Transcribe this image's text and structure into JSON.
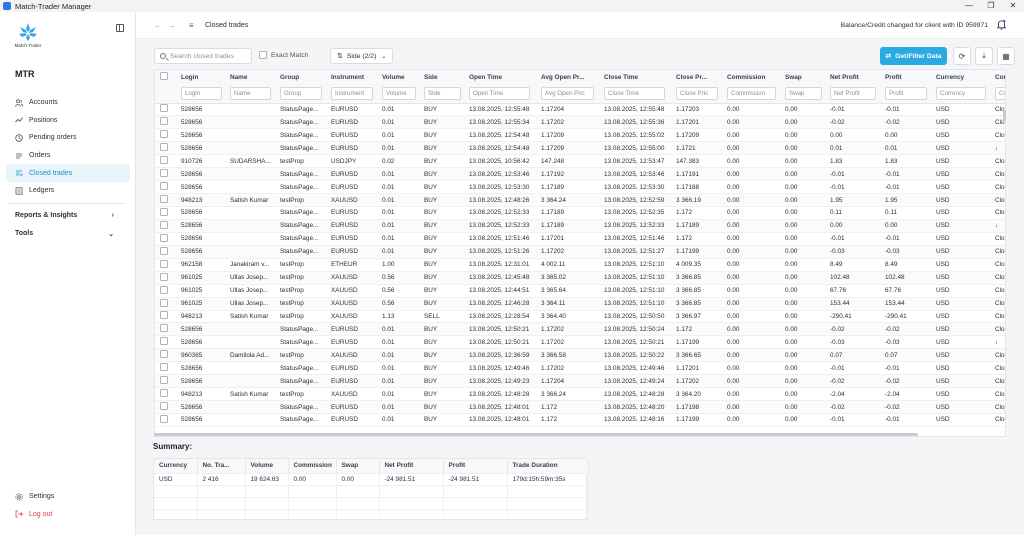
{
  "window": {
    "title": "Match-Trader Manager",
    "controls": [
      "—",
      "❐",
      "✕"
    ]
  },
  "sidebar": {
    "logo_text": "Match-Trader",
    "brand": "MTR",
    "items": [
      {
        "label": "Accounts",
        "icon": "users-icon"
      },
      {
        "label": "Positions",
        "icon": "positions-icon"
      },
      {
        "label": "Pending orders",
        "icon": "pending-icon"
      },
      {
        "label": "Orders",
        "icon": "orders-icon"
      },
      {
        "label": "Closed trades",
        "icon": "closed-trades-icon",
        "active": true
      },
      {
        "label": "Ledgers",
        "icon": "ledger-icon"
      }
    ],
    "groups": [
      {
        "label": "Reports & Insights",
        "chevron": "›"
      },
      {
        "label": "Tools",
        "chevron": "⌄"
      }
    ],
    "settings_label": "Settings",
    "logout_label": "Log out"
  },
  "header": {
    "back": "←",
    "forward": "→",
    "breadcrumb": "Closed trades",
    "notice": "Balance/Credit changed for client with ID 959971"
  },
  "toolbar": {
    "search_placeholder": "Search closed trades",
    "exact_match_label": "Exact Match",
    "side_label": "Side (2/2)",
    "get_filter_label": "Get/Filter Data",
    "refresh_icon": "⟳",
    "download_icon": "⤓",
    "columns_icon": "▦"
  },
  "table": {
    "columns": [
      "Login",
      "Name",
      "Group",
      "Instrument",
      "Volume",
      "Side",
      "Open Time",
      "Avg Open Pr...",
      "Close Time",
      "Close Pr...",
      "Commission",
      "Swap",
      "Net Profit",
      "Profit",
      "Currency",
      "Comm"
    ],
    "filters": [
      "Login",
      "Name",
      "Group",
      "Instrument",
      "Volume",
      "Side",
      "Open Time",
      "Avg Open Pric",
      "Close Time",
      "Close Pric",
      "Commission",
      "Swap",
      "Net Profit",
      "Profit",
      "Currency",
      "Comm"
    ],
    "rows": [
      [
        "528656",
        "",
        "StatusPage...",
        "EURUSD",
        "0.01",
        "BUY",
        "13.08.2025, 12:55:48",
        "1.17204",
        "13.08.2025, 12:55:48",
        "1.17203",
        "0.00",
        "0.00",
        "-0.01",
        "-0.01",
        "USD",
        "Clo"
      ],
      [
        "528656",
        "",
        "StatusPage...",
        "EURUSD",
        "0.01",
        "BUY",
        "13.08.2025, 12:55:34",
        "1.17202",
        "13.08.2025, 12:55:36",
        "1.17201",
        "0.00",
        "0.00",
        "-0.02",
        "-0.02",
        "USD",
        "Clo"
      ],
      [
        "528656",
        "",
        "StatusPage...",
        "EURUSD",
        "0.01",
        "BUY",
        "13.08.2025, 12:54:48",
        "1.17209",
        "13.08.2025, 12:55:02",
        "1.17209",
        "0.00",
        "0.00",
        "0.00",
        "0.00",
        "USD",
        "Clo"
      ],
      [
        "528656",
        "",
        "StatusPage...",
        "EURUSD",
        "0.01",
        "BUY",
        "13.08.2025, 12:54:48",
        "1.17209",
        "13.08.2025, 12:55:00",
        "1.1721",
        "0.00",
        "0.00",
        "0.01",
        "0.01",
        "USD",
        "↓"
      ],
      [
        "910726",
        "SUDARSHA...",
        "testProp",
        "USDJPY",
        "0.02",
        "BUY",
        "13.08.2025, 10:56:42",
        "147.248",
        "13.08.2025, 12:53:47",
        "147.383",
        "0.00",
        "0.00",
        "1.83",
        "1.83",
        "USD",
        "Clo"
      ],
      [
        "528656",
        "",
        "StatusPage...",
        "EURUSD",
        "0.01",
        "BUY",
        "13.08.2025, 12:53:46",
        "1.17192",
        "13.08.2025, 12:53:46",
        "1.17191",
        "0.00",
        "0.00",
        "-0.01",
        "-0.01",
        "USD",
        "Clo"
      ],
      [
        "528656",
        "",
        "StatusPage...",
        "EURUSD",
        "0.01",
        "BUY",
        "13.08.2025, 12:53:30",
        "1.17189",
        "13.08.2025, 12:53:30",
        "1.17188",
        "0.00",
        "0.00",
        "-0.01",
        "-0.01",
        "USD",
        "Clo"
      ],
      [
        "948213",
        "Satish Kumar",
        "testProp",
        "XAUUSD",
        "0.01",
        "BUY",
        "13.08.2025, 12:48:26",
        "3 364.24",
        "13.08.2025, 12:52:59",
        "3 366.19",
        "0.00",
        "0.00",
        "1.95",
        "1.95",
        "USD",
        "Clo"
      ],
      [
        "528656",
        "",
        "StatusPage...",
        "EURUSD",
        "0.01",
        "BUY",
        "13.08.2025, 12:52:33",
        "1.17189",
        "13.08.2025, 12:52:35",
        "1.172",
        "0.00",
        "0.00",
        "0.11",
        "0.11",
        "USD",
        "Clo"
      ],
      [
        "528656",
        "",
        "StatusPage...",
        "EURUSD",
        "0.01",
        "BUY",
        "13.08.2025, 12:52:33",
        "1.17189",
        "13.08.2025, 12:52:33",
        "1.17189",
        "0.00",
        "0.00",
        "0.00",
        "0.00",
        "USD",
        "↓"
      ],
      [
        "528656",
        "",
        "StatusPage...",
        "EURUSD",
        "0.01",
        "BUY",
        "13.08.2025, 12:51:46",
        "1.17201",
        "13.08.2025, 12:51:46",
        "1.172",
        "0.00",
        "0.00",
        "-0.01",
        "-0.01",
        "USD",
        "Clo"
      ],
      [
        "528656",
        "",
        "StatusPage...",
        "EURUSD",
        "0.01",
        "BUY",
        "13.08.2025, 12:51:26",
        "1.17202",
        "13.08.2025, 12:51:27",
        "1.17199",
        "0.00",
        "0.00",
        "-0.03",
        "-0.03",
        "USD",
        "Clo"
      ],
      [
        "962158",
        "Janakiram v...",
        "testProp",
        "ETHEUR",
        "1.00",
        "BUY",
        "13.08.2025, 12:31:01",
        "4 002.11",
        "13.08.2025, 12:51:10",
        "4 009.35",
        "0.00",
        "0.00",
        "8.49",
        "8.49",
        "USD",
        "Clo"
      ],
      [
        "961025",
        "Ullas Josep...",
        "testProp",
        "XAUUSD",
        "0.56",
        "BUY",
        "13.08.2025, 12:45:48",
        "3 365.02",
        "13.08.2025, 12:51:10",
        "3 366.85",
        "0.00",
        "0.00",
        "102.48",
        "102.48",
        "USD",
        "Clo"
      ],
      [
        "961025",
        "Ullas Josep...",
        "testProp",
        "XAUUSD",
        "0.56",
        "BUY",
        "13.08.2025, 12:44:51",
        "3 365.64",
        "13.08.2025, 12:51:10",
        "3 366.85",
        "0.00",
        "0.00",
        "67.76",
        "67.76",
        "USD",
        "Clo"
      ],
      [
        "961025",
        "Ullas Josep...",
        "testProp",
        "XAUUSD",
        "0.56",
        "BUY",
        "13.08.2025, 12:46:28",
        "3 364.11",
        "13.08.2025, 12:51:10",
        "3 366.85",
        "0.00",
        "0.00",
        "153.44",
        "153.44",
        "USD",
        "Clo"
      ],
      [
        "948213",
        "Satish Kumar",
        "testProp",
        "XAUUSD",
        "1.13",
        "SELL",
        "13.08.2025, 12:28:54",
        "3 364.40",
        "13.08.2025, 12:50:50",
        "3 366.97",
        "0.00",
        "0.00",
        "-290.41",
        "-290.41",
        "USD",
        "Clo"
      ],
      [
        "528656",
        "",
        "StatusPage...",
        "EURUSD",
        "0.01",
        "BUY",
        "13.08.2025, 12:50:21",
        "1.17202",
        "13.08.2025, 12:50:24",
        "1.172",
        "0.00",
        "0.00",
        "-0.02",
        "-0.02",
        "USD",
        "Clo"
      ],
      [
        "528656",
        "",
        "StatusPage...",
        "EURUSD",
        "0.01",
        "BUY",
        "13.08.2025, 12:50:21",
        "1.17202",
        "13.08.2025, 12:50:21",
        "1.17199",
        "0.00",
        "0.00",
        "-0.03",
        "-0.03",
        "USD",
        "↓"
      ],
      [
        "960365",
        "Damilola Ad...",
        "testProp",
        "XAUUSD",
        "0.01",
        "BUY",
        "13.08.2025, 12:36:59",
        "3 366.58",
        "13.08.2025, 12:50:22",
        "3 366.65",
        "0.00",
        "0.00",
        "0.07",
        "0.07",
        "USD",
        "Clo"
      ],
      [
        "528656",
        "",
        "StatusPage...",
        "EURUSD",
        "0.01",
        "BUY",
        "13.08.2025, 12:49:46",
        "1.17202",
        "13.08.2025, 12:49:46",
        "1.17201",
        "0.00",
        "0.00",
        "-0.01",
        "-0.01",
        "USD",
        "Clo"
      ],
      [
        "528656",
        "",
        "StatusPage...",
        "EURUSD",
        "0.01",
        "BUY",
        "13.08.2025, 12:49:23",
        "1.17204",
        "13.08.2025, 12:49:24",
        "1.17202",
        "0.00",
        "0.00",
        "-0.02",
        "-0.02",
        "USD",
        "Clo"
      ],
      [
        "948213",
        "Satish Kumar",
        "testProp",
        "XAUUSD",
        "0.01",
        "BUY",
        "13.08.2025, 12:48:28",
        "3 366.24",
        "13.08.2025, 12:48:28",
        "3 364.20",
        "0.00",
        "0.00",
        "-2.04",
        "-2.04",
        "USD",
        "Clo"
      ],
      [
        "528656",
        "",
        "StatusPage...",
        "EURUSD",
        "0.01",
        "BUY",
        "13.08.2025, 12:48:01",
        "1.172",
        "13.08.2025, 12:48:20",
        "1.17198",
        "0.00",
        "0.00",
        "-0.02",
        "-0.02",
        "USD",
        "Clo"
      ],
      [
        "528656",
        "",
        "StatusPage...",
        "EURUSD",
        "0.01",
        "BUY",
        "13.08.2025, 12:48:01",
        "1.172",
        "13.08.2025, 12:48:16",
        "1.17199",
        "0.00",
        "0.00",
        "-0.01",
        "-0.01",
        "USD",
        "Clo"
      ]
    ]
  },
  "summary": {
    "title": "Summary:",
    "columns": [
      "Currency",
      "No. Tra...",
      "Volume",
      "Commission",
      "Swap",
      "Net Profit",
      "Profit",
      "Trade Duration"
    ],
    "rows": [
      [
        "USD",
        "2 416",
        "19 624.63",
        "0.00",
        "0.00",
        "-24 981.51",
        "-24 981.51",
        "179d:15h:59m:35s"
      ]
    ]
  },
  "colors": {
    "accent": "#29abe2",
    "active_bg": "#e8f5fb",
    "logout": "#e0404a"
  }
}
